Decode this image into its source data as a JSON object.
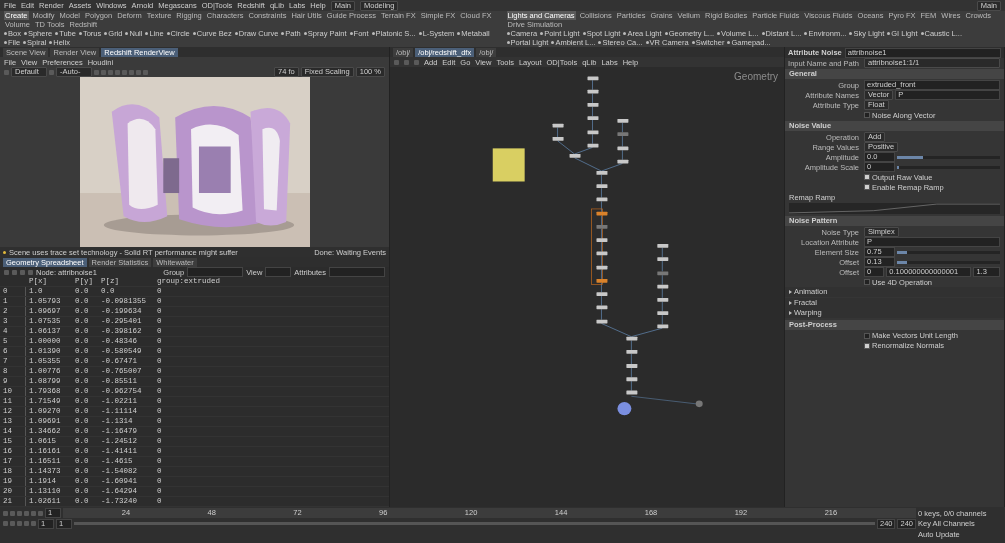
{
  "menu_bar": {
    "items": [
      "File",
      "Edit",
      "Render",
      "Assets",
      "Windows",
      "Arnold",
      "Megascans",
      "OD|Tools",
      "Redshift",
      "qLib",
      "Labs",
      "Help"
    ],
    "build": "Main",
    "desktop": "Modeling",
    "right_label": "Main"
  },
  "shelf_left": {
    "tabs": [
      {
        "label": "Create",
        "selected": true
      },
      {
        "label": "Modify",
        "selected": false
      },
      {
        "label": "Model",
        "selected": false
      },
      {
        "label": "Polygon",
        "selected": false
      },
      {
        "label": "Deform",
        "selected": false
      },
      {
        "label": "Texture",
        "selected": false
      },
      {
        "label": "Rigging",
        "selected": false
      },
      {
        "label": "Characters",
        "selected": false
      },
      {
        "label": "Constraints",
        "selected": false
      },
      {
        "label": "Hair Utils",
        "selected": false
      },
      {
        "label": "Guide Process",
        "selected": false
      },
      {
        "label": "Terrain FX",
        "selected": false
      },
      {
        "label": "Simple FX",
        "selected": false
      },
      {
        "label": "Cloud FX",
        "selected": false
      },
      {
        "label": "Volume",
        "selected": false
      },
      {
        "label": "TD Tools",
        "selected": false
      },
      {
        "label": "Redshift",
        "selected": false
      }
    ],
    "tools": [
      "Box",
      "Sphere",
      "Tube",
      "Torus",
      "Grid",
      "Null",
      "Line",
      "Circle",
      "Curve Bez",
      "Draw Curve",
      "Path",
      "Spray Paint",
      "Font",
      "Platonic S...",
      "L-System",
      "Metaball",
      "File",
      "Spiral",
      "Helix"
    ]
  },
  "shelf_right": {
    "tabs": [
      {
        "label": "Lights and Cameras",
        "selected": true
      },
      {
        "label": "Collisions",
        "selected": false
      },
      {
        "label": "Particles",
        "selected": false
      },
      {
        "label": "Grains",
        "selected": false
      },
      {
        "label": "Vellum",
        "selected": false
      },
      {
        "label": "Rigid Bodies",
        "selected": false
      },
      {
        "label": "Particle Fluids",
        "selected": false
      },
      {
        "label": "Viscous Fluids",
        "selected": false
      },
      {
        "label": "Oceans",
        "selected": false
      },
      {
        "label": "Pyro FX",
        "selected": false
      },
      {
        "label": "FEM",
        "selected": false
      },
      {
        "label": "Wires",
        "selected": false
      },
      {
        "label": "Crowds",
        "selected": false
      },
      {
        "label": "Drive Simulation",
        "selected": false
      }
    ],
    "tools": [
      "Camera",
      "Point Light",
      "Spot Light",
      "Area Light",
      "Geometry L...",
      "Volume L...",
      "Distant L...",
      "Environm...",
      "Sky Light",
      "GI Light",
      "Caustic L...",
      "Portal Light",
      "Ambient L...",
      "Stereo Ca...",
      "VR Camera",
      "Switcher",
      "Gamepad..."
    ]
  },
  "viewer": {
    "tabs": [
      {
        "label": "Scene View",
        "selected": false
      },
      {
        "label": "Render View",
        "selected": false
      },
      {
        "label": "Redshift RenderView",
        "selected": true
      }
    ],
    "menu": [
      "File",
      "View",
      "Preferences",
      "Houdini"
    ],
    "camera": "Default",
    "aov": "-Auto-",
    "zoom_fov": "74 fo",
    "scaling": "Fixed Scaling",
    "percent": "100 %",
    "status": "Scene uses trace set technology - Solid RT performance might suffer",
    "status_right": "Done: Waiting Events"
  },
  "spreadsheet": {
    "tabs": [
      {
        "label": "Geometry Spreadsheet",
        "selected": true
      },
      {
        "label": "Render Statistics",
        "selected": false
      },
      {
        "label": "Whitewater",
        "selected": false
      }
    ],
    "node": "Node: attribnoise1",
    "group_label": "Group",
    "view_label": "View",
    "attributes_label": "Attributes",
    "columns": [
      "P[x]",
      "P[y]",
      "P[z]",
      "group:extruded"
    ],
    "rows": [
      {
        "index": "0",
        "cells": [
          "1.0",
          "0.0",
          "0.0",
          "0"
        ]
      },
      {
        "index": "1",
        "cells": [
          "1.05793",
          "0.0",
          "-0.0981355",
          "0"
        ]
      },
      {
        "index": "2",
        "cells": [
          "1.09697",
          "0.0",
          "-0.199634",
          "0"
        ]
      },
      {
        "index": "3",
        "cells": [
          "1.07535",
          "0.0",
          "-0.295401",
          "0"
        ]
      },
      {
        "index": "4",
        "cells": [
          "1.06137",
          "0.0",
          "-0.398162",
          "0"
        ]
      },
      {
        "index": "5",
        "cells": [
          "1.00000",
          "0.0",
          "-0.48346",
          "0"
        ]
      },
      {
        "index": "6",
        "cells": [
          "1.01390",
          "0.0",
          "-0.580549",
          "0"
        ]
      },
      {
        "index": "7",
        "cells": [
          "1.05355",
          "0.0",
          "-0.67471",
          "0"
        ]
      },
      {
        "index": "8",
        "cells": [
          "1.00776",
          "0.0",
          "-0.765007",
          "0"
        ]
      },
      {
        "index": "9",
        "cells": [
          "1.08799",
          "0.0",
          "-0.85511",
          "0"
        ]
      },
      {
        "index": "10",
        "cells": [
          "1.79368",
          "0.0",
          "-0.962754",
          "0"
        ]
      },
      {
        "index": "11",
        "cells": [
          "1.71549",
          "0.0",
          "-1.02211",
          "0"
        ]
      },
      {
        "index": "12",
        "cells": [
          "1.09270",
          "0.0",
          "-1.11114",
          "0"
        ]
      },
      {
        "index": "13",
        "cells": [
          "1.09691",
          "0.0",
          "-1.1314",
          "0"
        ]
      },
      {
        "index": "14",
        "cells": [
          "1.34662",
          "0.0",
          "-1.16479",
          "0"
        ]
      },
      {
        "index": "15",
        "cells": [
          "1.0615",
          "0.0",
          "-1.24512",
          "0"
        ]
      },
      {
        "index": "16",
        "cells": [
          "1.16161",
          "0.0",
          "-1.41411",
          "0"
        ]
      },
      {
        "index": "17",
        "cells": [
          "1.16511",
          "0.0",
          "-1.4615",
          "0"
        ]
      },
      {
        "index": "18",
        "cells": [
          "1.14373",
          "0.0",
          "-1.54082",
          "0"
        ]
      },
      {
        "index": "19",
        "cells": [
          "1.1914",
          "0.0",
          "-1.60941",
          "0"
        ]
      },
      {
        "index": "20",
        "cells": [
          "1.13110",
          "0.0",
          "-1.64294",
          "0"
        ]
      },
      {
        "index": "21",
        "cells": [
          "1.02611",
          "0.0",
          "-1.73240",
          "0"
        ]
      }
    ]
  },
  "network": {
    "tabs": [
      {
        "label": "/obj/",
        "selected": false
      },
      {
        "label": "/obj/redshift_dfx",
        "selected": true
      },
      {
        "label": "/obj/",
        "selected": false
      }
    ],
    "menu": [
      "Add",
      "Edit",
      "Go",
      "View",
      "Tools",
      "Layout",
      "OD|Tools",
      "qLib",
      "Labs",
      "Help"
    ],
    "context": "Geometry"
  },
  "parameters": {
    "type": "Attribute Noise",
    "name": "attribnoise1",
    "path_label": "Input Name and Path",
    "path_value": "attribnoise1:1/1",
    "items": [
      {
        "kind": "section",
        "label": "General"
      },
      {
        "kind": "field",
        "label": "Group",
        "value": "extruded_front"
      },
      {
        "kind": "menu_field",
        "label": "Attribute Names",
        "menu": "Vector",
        "value": "P"
      },
      {
        "kind": "menu",
        "label": "Attribute Type",
        "value": "Float"
      },
      {
        "kind": "checkbox",
        "label": "Noise Along Vector",
        "checked": false
      },
      {
        "kind": "section",
        "label": "Noise Value"
      },
      {
        "kind": "menu",
        "label": "Operation",
        "value": "Add"
      },
      {
        "kind": "menu",
        "label": "Range Values",
        "value": "Positive"
      },
      {
        "kind": "slider",
        "label": "Amplitude",
        "value": "0.0",
        "level": 0.25
      },
      {
        "kind": "slider",
        "label": "Amplitude Scale",
        "value": "0",
        "level": 0.0
      },
      {
        "kind": "checkbox",
        "label": "Output Raw Value",
        "checked": true
      },
      {
        "kind": "checkbox",
        "label": "Enable Remap Ramp",
        "checked": true
      },
      {
        "kind": "ramp",
        "label": "Remap Ramp"
      },
      {
        "kind": "section",
        "label": "Noise Pattern"
      },
      {
        "kind": "menu",
        "label": "Noise Type",
        "value": "Simplex"
      },
      {
        "kind": "field",
        "label": "Location Attribute",
        "value": "P"
      },
      {
        "kind": "slider",
        "label": "Element Size",
        "value": "0.75",
        "level": 0.1
      },
      {
        "kind": "slider",
        "label": "Offset",
        "value": "0.13",
        "level": 0.1
      },
      {
        "kind": "vector",
        "label": "Offset",
        "values": [
          "0",
          "0.100000000000001",
          "1.3"
        ]
      },
      {
        "kind": "checkbox",
        "label": "Use 4D Operation",
        "checked": false
      },
      {
        "kind": "folder",
        "label": "Animation"
      },
      {
        "kind": "folder",
        "label": "Fractal"
      },
      {
        "kind": "folder",
        "label": "Warping"
      },
      {
        "kind": "section",
        "label": "Post-Process"
      },
      {
        "kind": "checkbox",
        "label": "Make Vectors Unit Length",
        "checked": false
      },
      {
        "kind": "checkbox",
        "label": "Renormalize Normals",
        "checked": true
      }
    ]
  },
  "timeline": {
    "ticks": [
      "24",
      "48",
      "72",
      "96",
      "120",
      "144",
      "168",
      "192",
      "216"
    ],
    "frame": "1",
    "start": "1",
    "range_start": "1",
    "range_end": "240",
    "end": "240",
    "keys": "0 keys, 0/0 channels",
    "key_all": "Key All Channels",
    "auto_update": "Auto Update"
  }
}
